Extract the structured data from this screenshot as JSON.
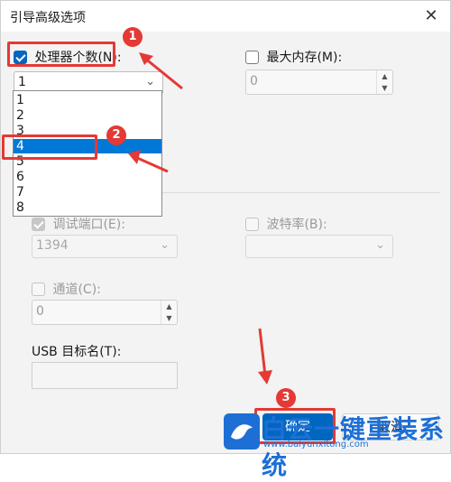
{
  "window": {
    "title": "引导高级选项",
    "close_glyph": "✕"
  },
  "processor": {
    "label": "处理器个数(N):",
    "checked": true,
    "value": "1"
  },
  "max_memory": {
    "label": "最大内存(M):",
    "checked": false,
    "value": "0"
  },
  "dropdown_options": [
    "1",
    "2",
    "3",
    "4",
    "5",
    "6",
    "7",
    "8"
  ],
  "dropdown_selected": "4",
  "debug": {
    "debug_port_label": "调试端口(E):",
    "debug_port_value": "1394",
    "baud_label": "波特率(B):",
    "channel_label": "通道(C):",
    "channel_value": "0",
    "usb_label": "USB 目标名(T):"
  },
  "buttons": {
    "ok": "确定",
    "cancel": "取消"
  },
  "annotations": {
    "step1": "1",
    "step2": "2",
    "step3": "3",
    "color": "#e53935"
  },
  "watermark": {
    "text": "白云一键重装系统",
    "url": "www.baiyunxitong.com"
  },
  "colors": {
    "accent": "#0067c0",
    "selection": "#0078d7"
  }
}
